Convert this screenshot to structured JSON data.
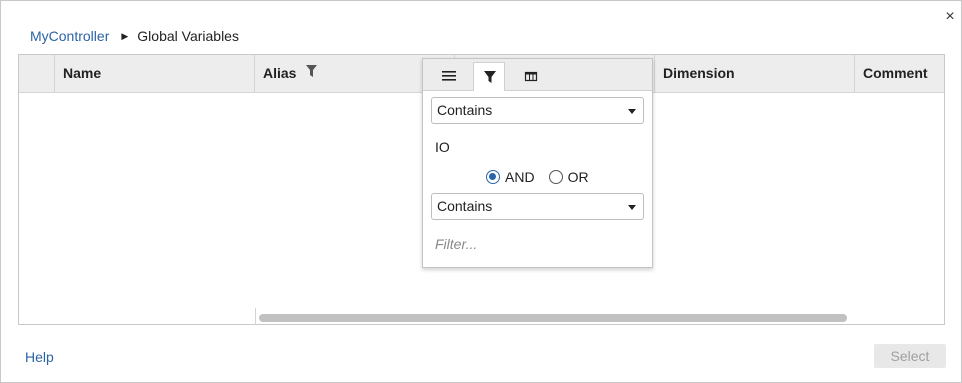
{
  "dialog": {
    "close_glyph": "×"
  },
  "breadcrumb": {
    "parent": "MyController",
    "separator": "▶",
    "current": "Global Variables"
  },
  "grid": {
    "columns": [
      {
        "label": "",
        "key": "selector"
      },
      {
        "label": "Name",
        "key": "name"
      },
      {
        "label": "Alias",
        "key": "alias",
        "filtered": true
      },
      {
        "label": "",
        "key": "hidden"
      },
      {
        "label": "Dimension",
        "key": "dimension"
      },
      {
        "label": "Comment",
        "key": "comment"
      }
    ],
    "rows": []
  },
  "filter_popup": {
    "tabs": [
      {
        "icon": "menu-icon",
        "active": false
      },
      {
        "icon": "filter-icon",
        "active": true
      },
      {
        "icon": "columns-icon",
        "active": false
      }
    ],
    "condition1": "Contains",
    "value1": "IO",
    "operator": {
      "and_label": "AND",
      "or_label": "OR",
      "selected": "AND"
    },
    "condition2": "Contains",
    "value2": "",
    "value2_placeholder": "Filter..."
  },
  "footer": {
    "help_label": "Help",
    "select_label": "Select",
    "select_enabled": false
  },
  "colors": {
    "link": "#2b63a6",
    "header_bg": "#ededed",
    "disabled_button_bg": "#e8e8e8",
    "disabled_button_text": "#a0a0a0"
  }
}
